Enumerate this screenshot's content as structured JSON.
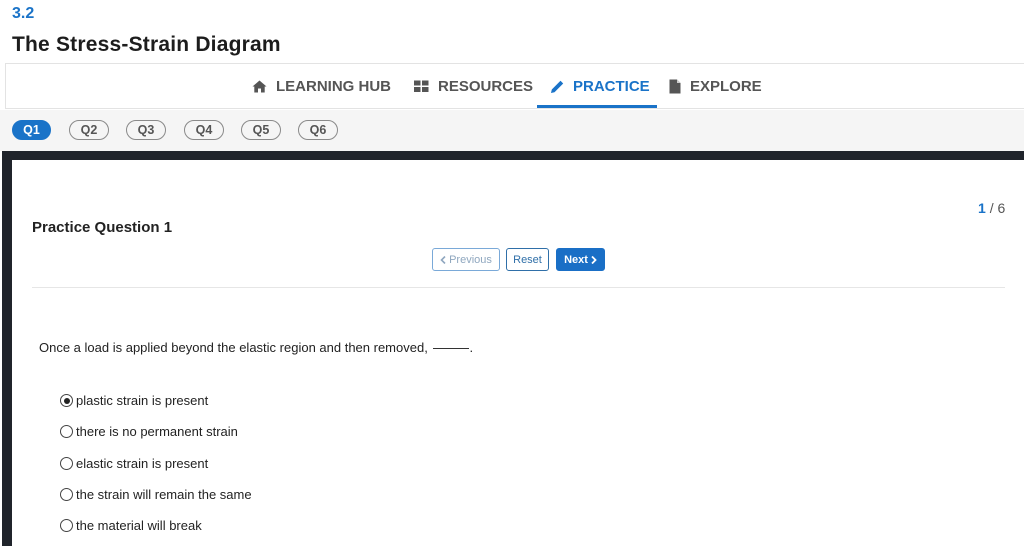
{
  "header": {
    "section_number": "3.2",
    "title": "The Stress-Strain Diagram"
  },
  "tabs": [
    {
      "label": "LEARNING HUB",
      "icon": "home-icon",
      "active": false
    },
    {
      "label": "RESOURCES",
      "icon": "grid-icon",
      "active": false
    },
    {
      "label": "PRACTICE",
      "icon": "pencil-icon",
      "active": true
    },
    {
      "label": "EXPLORE",
      "icon": "document-icon",
      "active": false
    }
  ],
  "question_pills": [
    {
      "label": "Q1",
      "active": true
    },
    {
      "label": "Q2",
      "active": false
    },
    {
      "label": "Q3",
      "active": false
    },
    {
      "label": "Q4",
      "active": false
    },
    {
      "label": "Q5",
      "active": false
    },
    {
      "label": "Q6",
      "active": false
    }
  ],
  "practice": {
    "counter_current": "1",
    "counter_total": "/ 6",
    "title": "Practice Question 1",
    "buttons": {
      "previous": "Previous",
      "reset": "Reset",
      "next": "Next"
    },
    "question_text": "Once a load is applied beyond the elastic region and then removed,",
    "question_end": ".",
    "options": [
      {
        "label": "plastic strain is present",
        "selected": true
      },
      {
        "label": "there is no permanent strain",
        "selected": false
      },
      {
        "label": "elastic strain is present",
        "selected": false
      },
      {
        "label": "the strain will remain the same",
        "selected": false
      },
      {
        "label": "the material will break",
        "selected": false
      }
    ]
  },
  "colors": {
    "accent": "#1a73c8",
    "frame": "#20242b",
    "pill_bar": "#f5f5f5"
  }
}
